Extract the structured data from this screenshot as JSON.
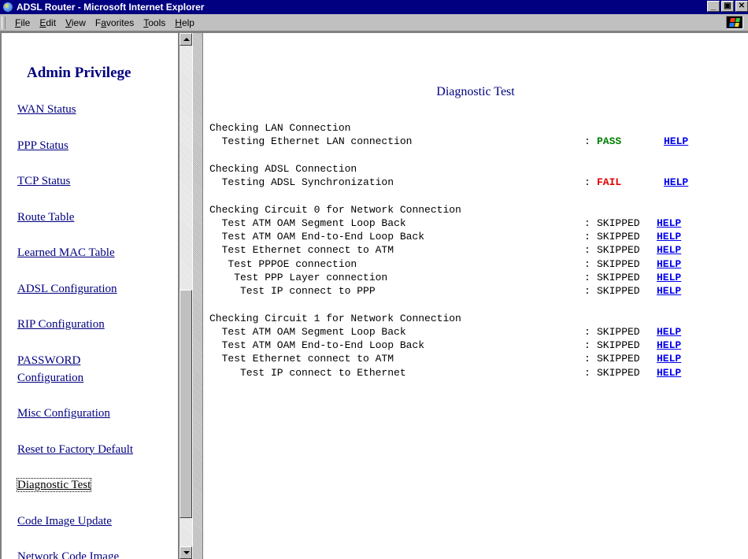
{
  "window": {
    "title": "ADSL Router - Microsoft Internet Explorer",
    "minimize_label": "_",
    "maximize_label": "▣",
    "close_label": "✕"
  },
  "menu": [
    "File",
    "Edit",
    "View",
    "Favorites",
    "Tools",
    "Help"
  ],
  "menu_underline_index": [
    0,
    0,
    0,
    1,
    0,
    0
  ],
  "sidebar": {
    "title": "Admin Privilege",
    "items": [
      {
        "label": "WAN Status"
      },
      {
        "label": "PPP Status"
      },
      {
        "label": "TCP Status"
      },
      {
        "label": "Route Table"
      },
      {
        "label": "Learned MAC Table"
      },
      {
        "label": "ADSL Configuration"
      },
      {
        "label": "RIP Configuration"
      },
      {
        "label": "PASSWORD",
        "label2": "Configuration"
      },
      {
        "label": "Misc Configuration"
      },
      {
        "label": "Reset to Factory Default"
      },
      {
        "label": "Diagnostic Test",
        "active": true
      },
      {
        "label": "Code Image Update"
      },
      {
        "label": "Network Code Image"
      }
    ]
  },
  "content": {
    "title": "Diagnostic Test",
    "help_label": "HELP",
    "sections": [
      {
        "heading": "Checking LAN Connection",
        "tests": [
          {
            "label": "Testing Ethernet LAN connection",
            "indent": 2,
            "status": "PASS",
            "kind": "pass"
          }
        ]
      },
      {
        "heading": "Checking ADSL Connection",
        "tests": [
          {
            "label": "Testing ADSL Synchronization",
            "indent": 2,
            "status": "FAIL",
            "kind": "fail"
          }
        ]
      },
      {
        "heading": "Checking Circuit 0 for Network Connection",
        "tests": [
          {
            "label": "Test ATM OAM Segment Loop Back",
            "indent": 2,
            "status": "SKIPPED",
            "kind": "skip"
          },
          {
            "label": "Test ATM OAM End-to-End Loop Back",
            "indent": 2,
            "status": "SKIPPED",
            "kind": "skip"
          },
          {
            "label": "Test Ethernet connect to ATM",
            "indent": 2,
            "status": "SKIPPED",
            "kind": "skip"
          },
          {
            "label": "Test PPPOE connection",
            "indent": 3,
            "status": "SKIPPED",
            "kind": "skip"
          },
          {
            "label": "Test PPP Layer connection",
            "indent": 4,
            "status": "SKIPPED",
            "kind": "skip"
          },
          {
            "label": "Test IP connect to PPP",
            "indent": 5,
            "status": "SKIPPED",
            "kind": "skip"
          }
        ]
      },
      {
        "heading": "Checking Circuit 1 for Network Connection",
        "tests": [
          {
            "label": "Test ATM OAM Segment Loop Back",
            "indent": 2,
            "status": "SKIPPED",
            "kind": "skip"
          },
          {
            "label": "Test ATM OAM End-to-End Loop Back",
            "indent": 2,
            "status": "SKIPPED",
            "kind": "skip"
          },
          {
            "label": "Test Ethernet connect to ATM",
            "indent": 2,
            "status": "SKIPPED",
            "kind": "skip"
          },
          {
            "label": "Test IP connect to Ethernet",
            "indent": 5,
            "status": "SKIPPED",
            "kind": "skip"
          }
        ]
      }
    ]
  },
  "colors": {
    "titlebar": "#000080",
    "link": "#000080",
    "help_link": "#0000ee",
    "pass": "#008000",
    "fail": "#e00000"
  }
}
